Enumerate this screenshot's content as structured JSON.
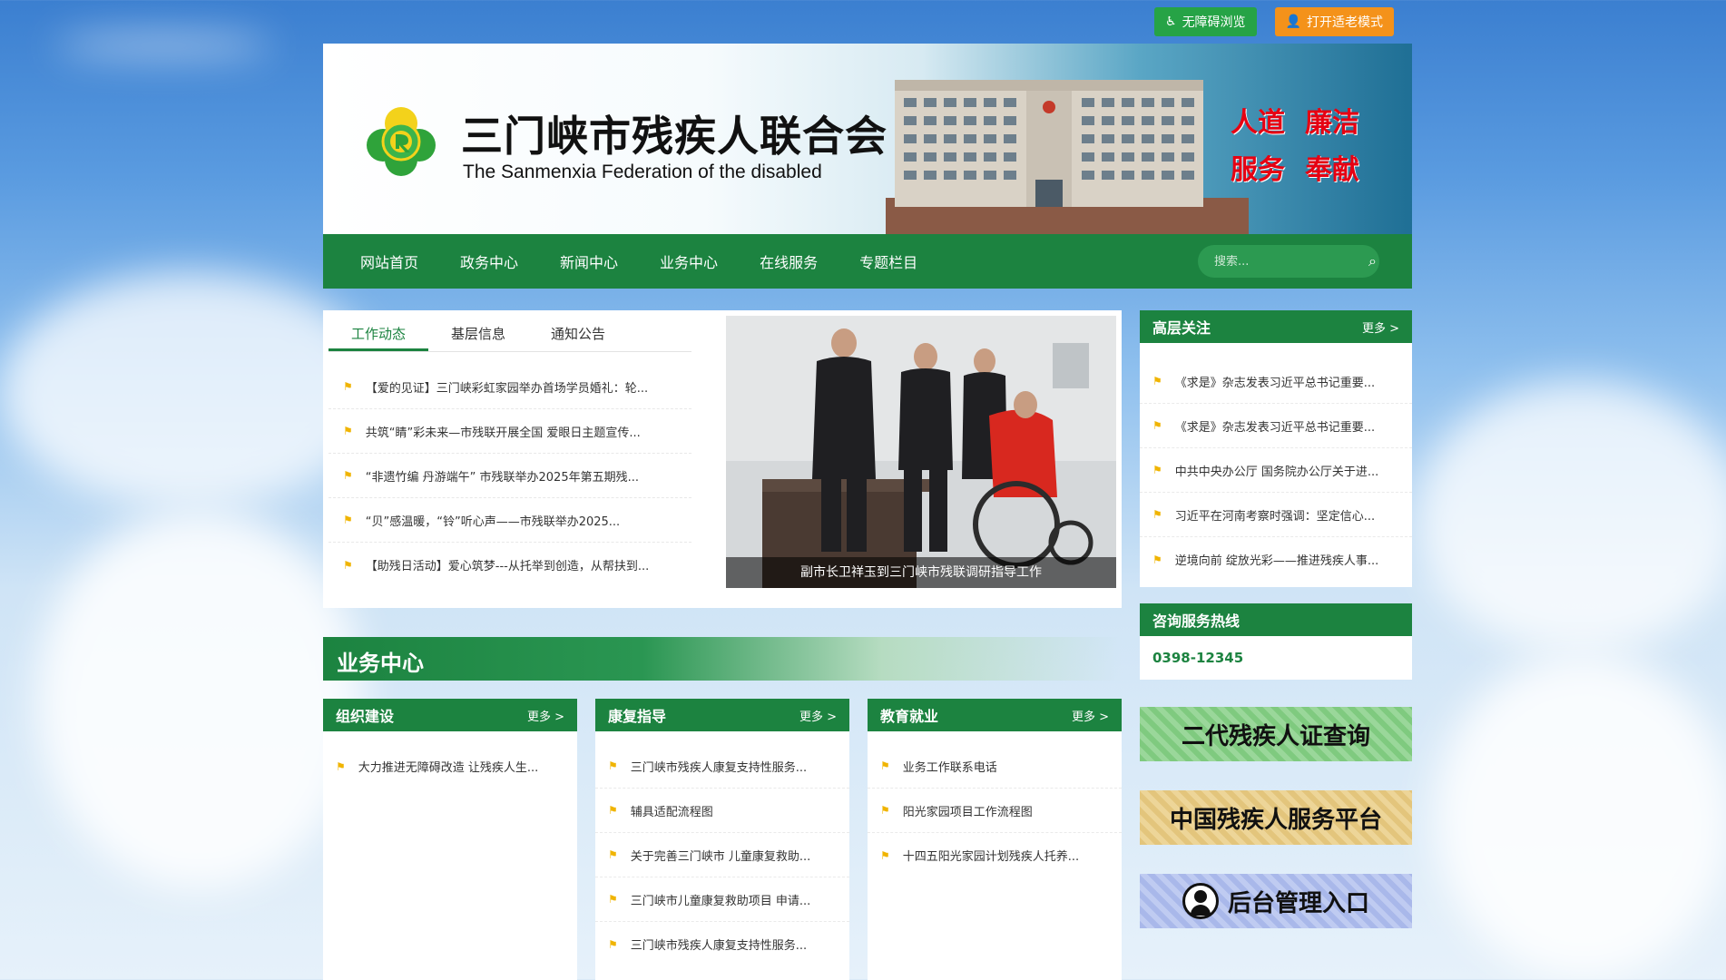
{
  "top_buttons": {
    "accessibility": "无障碍浏览",
    "elderly": "打开适老模式"
  },
  "banner": {
    "title": "三门峡市残疾人联合会",
    "subtitle": "The Sanmenxia Federation of the disabled",
    "slogan": [
      "人道",
      "廉洁",
      "服务",
      "奉献"
    ]
  },
  "nav": {
    "items": [
      "网站首页",
      "政务中心",
      "新闻中心",
      "业务中心",
      "在线服务",
      "专题栏目"
    ],
    "search_placeholder": "搜索..."
  },
  "news": {
    "tabs": [
      "工作动态",
      "基层信息",
      "通知公告"
    ],
    "items": [
      "【爱的见证】三门峡彩虹家园举办首场学员婚礼：轮...",
      "共筑“睛”彩未来—市残联开展全国 爱眼日主题宣传...",
      "“非遗竹编 丹游端午” 市残联举办2025年第五期残...",
      "“贝”感温暖，“铃”听心声——市残联举办2025...",
      "【助残日活动】爱心筑梦---从托举到创造，从帮扶到..."
    ],
    "photo_caption": "副市长卫祥玉到三门峡市残联调研指导工作"
  },
  "business": {
    "title": "业务中心",
    "more": "更多 >",
    "boxes": [
      {
        "title": "组织建设",
        "items": [
          "大力推进无障碍改造 让残疾人生..."
        ]
      },
      {
        "title": "康复指导",
        "items": [
          "三门峡市残疾人康复支持性服务...",
          "辅具适配流程图",
          "关于完善三门峡市 儿童康复救助...",
          "三门峡市儿童康复救助项目 申请...",
          "三门峡市残疾人康复支持性服务..."
        ]
      },
      {
        "title": "教育就业",
        "items": [
          "业务工作联系电话",
          "阳光家园项目工作流程图",
          "十四五阳光家园计划残疾人托养..."
        ]
      }
    ]
  },
  "sidebar": {
    "focus": {
      "title": "高层关注",
      "more": "更多 >",
      "items": [
        "《求是》杂志发表习近平总书记重要...",
        "《求是》杂志发表习近平总书记重要...",
        "中共中央办公厅 国务院办公厅关于进...",
        "习近平在河南考察时强调：坚定信心...",
        "逆境向前 绽放光彩——推进残疾人事..."
      ]
    },
    "hotline": {
      "title": "咨询服务热线",
      "number": "0398-12345"
    },
    "buttons": [
      "二代残疾人证查询",
      "中国残疾人服务平台",
      "后台管理入口"
    ]
  },
  "colors": {
    "primary": "#1c8340",
    "accent_red": "#e60012",
    "flag": "#f0b400"
  }
}
